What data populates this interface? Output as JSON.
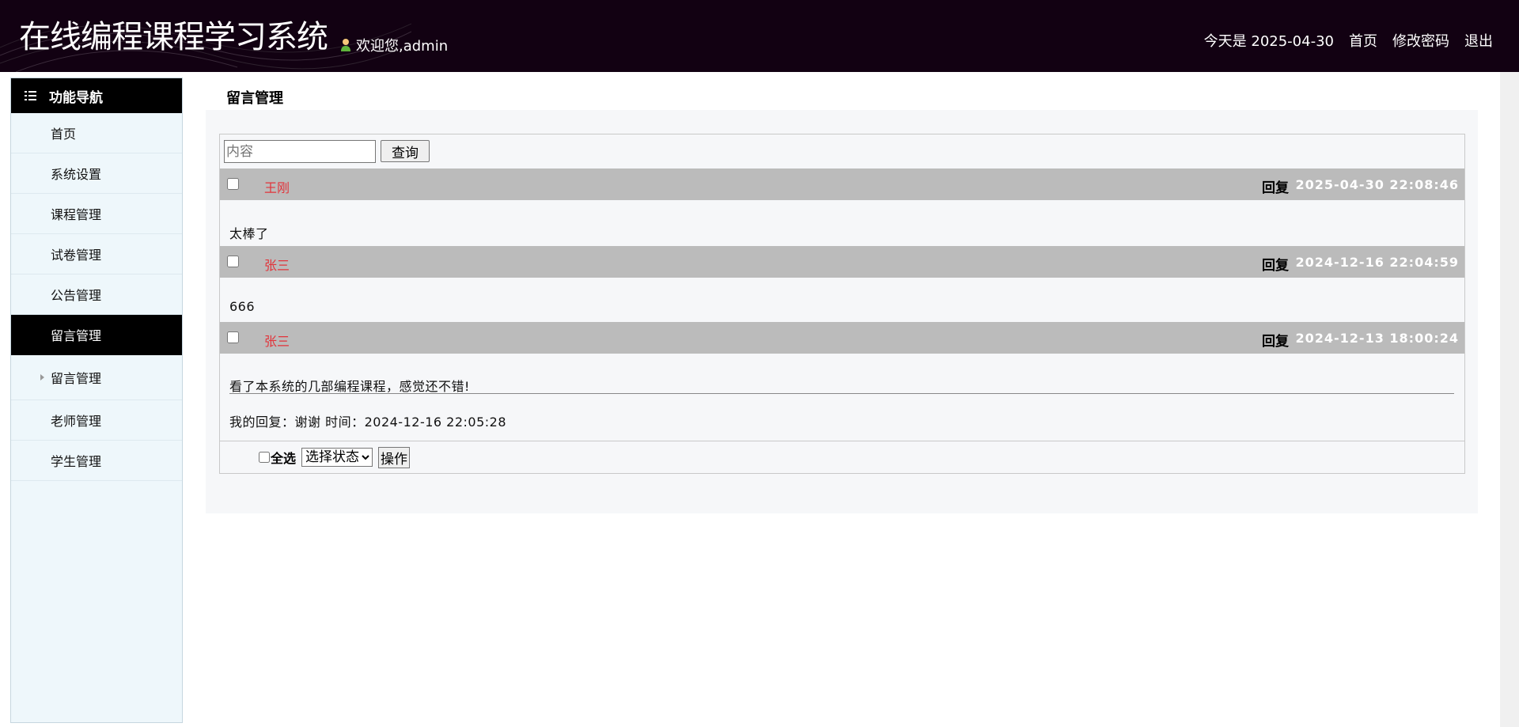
{
  "header": {
    "title": "在线编程课程学习系统",
    "welcome": "欢迎您,admin",
    "date_text": "今天是 2025-04-30",
    "links": {
      "home": "首页",
      "change_password": "修改密码",
      "logout": "退出"
    }
  },
  "sidebar": {
    "heading": "功能导航",
    "items": [
      "首页",
      "系统设置",
      "课程管理",
      "试卷管理",
      "公告管理",
      "留言管理"
    ],
    "active_item": "留言管理",
    "sub_item": "留言管理",
    "items_after": [
      "老师管理",
      "学生管理"
    ]
  },
  "main": {
    "page_title": "留言管理",
    "search": {
      "placeholder": "内容",
      "value": "",
      "button": "查询"
    },
    "messages": [
      {
        "author": "王刚",
        "reply_label": "回复",
        "time": "2025-04-30 22:08:46",
        "content": "太棒了",
        "reply": ""
      },
      {
        "author": "张三",
        "reply_label": "回复",
        "time": "2024-12-16 22:04:59",
        "content": "666",
        "reply": ""
      },
      {
        "author": "张三",
        "reply_label": "回复",
        "time": "2024-12-13 18:00:24",
        "content": "看了本系统的几部编程课程，感觉还不错!",
        "reply": "我的回复：谢谢 时间：2024-12-16 22:05:28"
      }
    ],
    "footer": {
      "select_all": "全选",
      "status_placeholder": "选择状态",
      "operate_button": "操作"
    }
  },
  "colors": {
    "header_bg": "#120112",
    "nav_active_bg": "#000000",
    "author_red": "#e2333a",
    "message_header_bg": "#bbbbbb"
  },
  "icons": {
    "nav_heading": "list-icon",
    "welcome": "user-icon",
    "sub_item": "triangle-right-icon"
  }
}
